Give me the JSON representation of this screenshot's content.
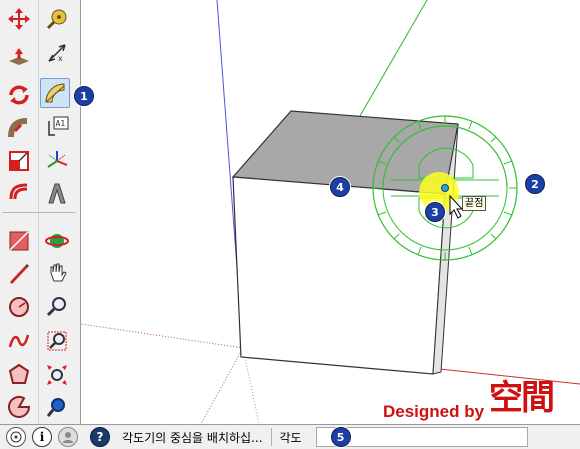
{
  "toolbar": {
    "tools_left": [
      "move-icon",
      "push-pull-icon",
      "rotate-icon",
      "follow-me-icon",
      "scale-icon",
      "offset-icon",
      "eraser-icon",
      "freehand-pencil-icon",
      "circle-icon",
      "arc-icon",
      "polygon-icon",
      "pie-icon"
    ],
    "tools_right": [
      "tape-measure-icon",
      "dimension-icon",
      "protractor-icon",
      "text-icon",
      "axes-icon",
      "3d-text-icon",
      "orbit-icon",
      "pan-icon",
      "zoom-icon",
      "zoom-window-icon",
      "zoom-extents-icon",
      "previous-view-icon"
    ],
    "active_tool": "protractor-icon"
  },
  "callouts": [
    "1",
    "2",
    "3",
    "4",
    "5"
  ],
  "viewport": {
    "tooltip": "끝점"
  },
  "statusbar": {
    "message": "각도기의 중심을 배치하십...",
    "measurement_label": "각도",
    "measurement_value": ""
  },
  "branding": {
    "text": "Designed by",
    "logo_text": "空間"
  },
  "colors": {
    "callout": "#1c3fa3",
    "protractor": "#22bb22",
    "highlight": "#ffff00",
    "brand": "#d01010"
  }
}
